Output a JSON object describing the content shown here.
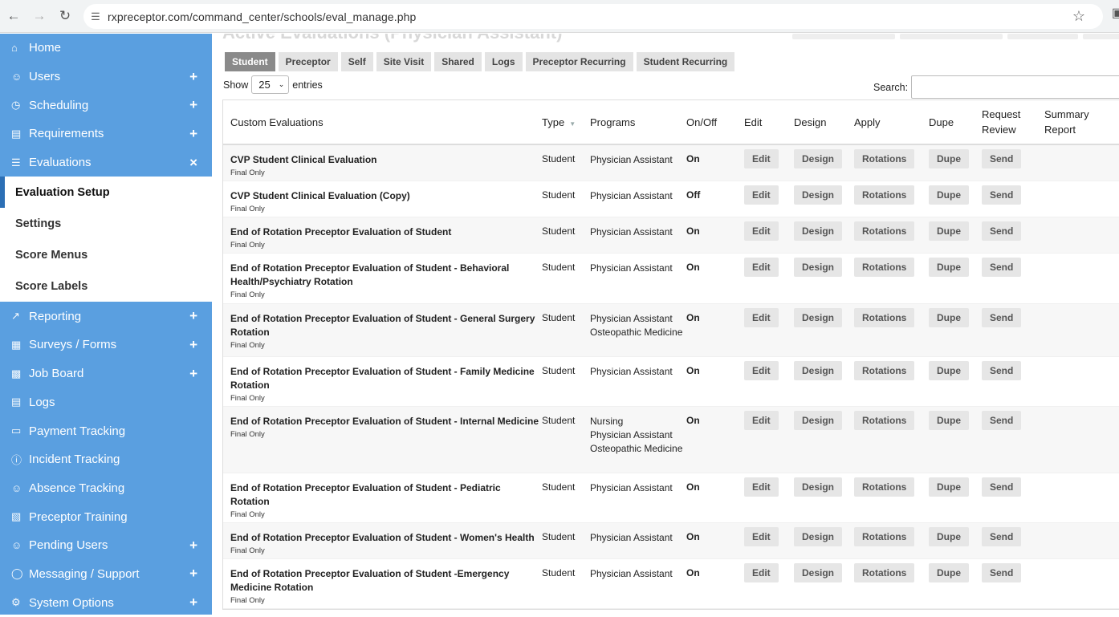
{
  "browser": {
    "url": "rxpreceptor.com/command_center/schools/eval_manage.php"
  },
  "page": {
    "faded_title": "Active Evaluations (Physician Assistant)"
  },
  "sidebar": {
    "items_top": [
      {
        "label": "Home",
        "icon": "home-icon",
        "expand": ""
      },
      {
        "label": "Users",
        "icon": "users-icon",
        "expand": "+"
      },
      {
        "label": "Scheduling",
        "icon": "scheduling-icon",
        "expand": "+"
      },
      {
        "label": "Requirements",
        "icon": "clipboard-icon",
        "expand": "+"
      },
      {
        "label": "Evaluations",
        "icon": "list-icon",
        "expand": "×"
      }
    ],
    "submenu": [
      "Evaluation Setup",
      "Settings",
      "Score Menus",
      "Score Labels"
    ],
    "items_bottom": [
      {
        "label": "Reporting",
        "icon": "chart-icon",
        "expand": "+"
      },
      {
        "label": "Surveys / Forms",
        "icon": "document-icon",
        "expand": "+"
      },
      {
        "label": "Job Board",
        "icon": "job-board-icon",
        "expand": "+"
      },
      {
        "label": "Logs",
        "icon": "logs-icon",
        "expand": ""
      },
      {
        "label": "Payment Tracking",
        "icon": "payment-icon",
        "expand": ""
      },
      {
        "label": "Incident Tracking",
        "icon": "incident-icon",
        "expand": ""
      },
      {
        "label": "Absence Tracking",
        "icon": "absence-icon",
        "expand": ""
      },
      {
        "label": "Preceptor Training",
        "icon": "training-icon",
        "expand": ""
      },
      {
        "label": "Pending Users",
        "icon": "pending-users-icon",
        "expand": "+"
      },
      {
        "label": "Messaging / Support",
        "icon": "message-icon",
        "expand": "+"
      },
      {
        "label": "System Options",
        "icon": "gears-icon",
        "expand": "+"
      }
    ]
  },
  "tabs": [
    "Student",
    "Preceptor",
    "Self",
    "Site Visit",
    "Shared",
    "Logs",
    "Preceptor Recurring",
    "Student Recurring"
  ],
  "controls": {
    "show_label": "Show",
    "entries_value": "25",
    "entries_label": "entries",
    "search_label": "Search:"
  },
  "table": {
    "headers": [
      "Custom Evaluations",
      "Type",
      "Programs",
      "On/Off",
      "Edit",
      "Design",
      "Apply",
      "Dupe",
      "Request Review",
      "Summary Report"
    ],
    "buttons": {
      "edit": "Edit",
      "design": "Design",
      "apply": "Rotations",
      "dupe": "Dupe",
      "request": "Send"
    },
    "rows": [
      {
        "name": "CVP Student Clinical Evaluation",
        "sub": "Final Only",
        "type": "Student",
        "programs": [
          "Physician Assistant"
        ],
        "status": "On",
        "height": 45
      },
      {
        "name": "CVP Student Clinical Evaluation (Copy)",
        "sub": "Final Only",
        "type": "Student",
        "programs": [
          "Physician Assistant"
        ],
        "status": "Off",
        "height": 45
      },
      {
        "name": "End of Rotation Preceptor Evaluation of Student",
        "sub": "Final Only",
        "type": "Student",
        "programs": [
          "Physician Assistant"
        ],
        "status": "On",
        "height": 45
      },
      {
        "name": "End of Rotation Preceptor Evaluation of Student - Behavioral Health/Psychiatry Rotation",
        "sub": "Final Only",
        "type": "Student",
        "programs": [
          "Physician Assistant"
        ],
        "status": "On",
        "height": 63
      },
      {
        "name": "End of Rotation Preceptor Evaluation of Student - General Surgery Rotation",
        "sub": "Final Only",
        "type": "Student",
        "programs": [
          "Physician Assistant",
          "Osteopathic Medicine"
        ],
        "status": "On",
        "height": 66
      },
      {
        "name": "End of Rotation Preceptor Evaluation of Student - Family Medicine Rotation",
        "sub": "Final Only",
        "type": "Student",
        "programs": [
          "Physician Assistant"
        ],
        "status": "On",
        "height": 62
      },
      {
        "name": "End of Rotation Preceptor Evaluation of Student - Internal Medicine",
        "sub": "Final Only",
        "type": "Student",
        "programs": [
          "Nursing",
          "Physician Assistant",
          "Osteopathic Medicine"
        ],
        "status": "On",
        "height": 83
      },
      {
        "name": "End of Rotation Preceptor Evaluation of Student - Pediatric Rotation",
        "sub": "Final Only",
        "type": "Student",
        "programs": [
          "Physician Assistant"
        ],
        "status": "On",
        "height": 62
      },
      {
        "name": "End of Rotation Preceptor Evaluation of Student - Women's Health",
        "sub": "Final Only",
        "type": "Student",
        "programs": [
          "Physician Assistant"
        ],
        "status": "On",
        "height": 45
      },
      {
        "name": "End of Rotation Preceptor Evaluation of Student -Emergency Medicine Rotation",
        "sub": "Final Only",
        "type": "Student",
        "programs": [
          "Physician Assistant"
        ],
        "status": "On",
        "height": 62
      }
    ]
  }
}
